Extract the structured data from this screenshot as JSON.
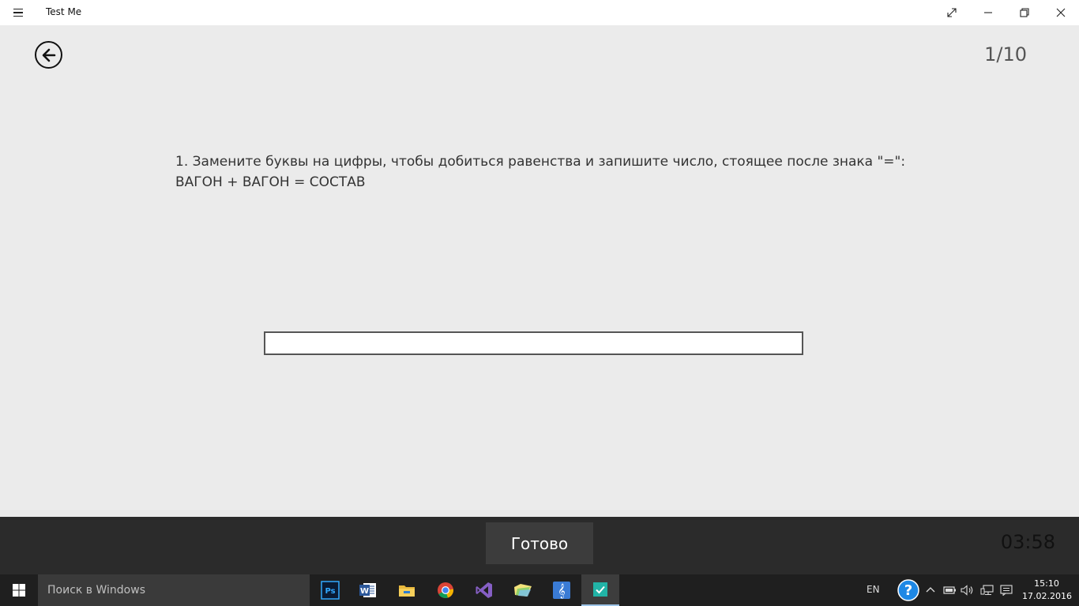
{
  "window": {
    "title": "Test Me"
  },
  "quiz": {
    "counter": "1/10",
    "question_line1": "1. Замените буквы на цифры, чтобы добиться равенства и запишите число, стоящее после знака \"=\":",
    "question_line2": "ВАГОН + ВАГОН = СОСТАВ",
    "answer_value": ""
  },
  "appbar": {
    "done_label": "Готово",
    "timer": "03:58"
  },
  "taskbar": {
    "search_placeholder": "Поиск в Windows",
    "apps": [
      "photoshop-icon",
      "word-icon",
      "file-explorer-icon",
      "chrome-icon",
      "visual-studio-icon",
      "folder-app-icon",
      "music-app-icon",
      "test-me-icon"
    ],
    "language": "EN",
    "time": "15:10",
    "date": "17.02.2016"
  },
  "colors": {
    "background": "#ebebeb",
    "appbar": "#2b2b2b",
    "taskbar": "#1f1f1f",
    "accent": "#21b3a6"
  }
}
